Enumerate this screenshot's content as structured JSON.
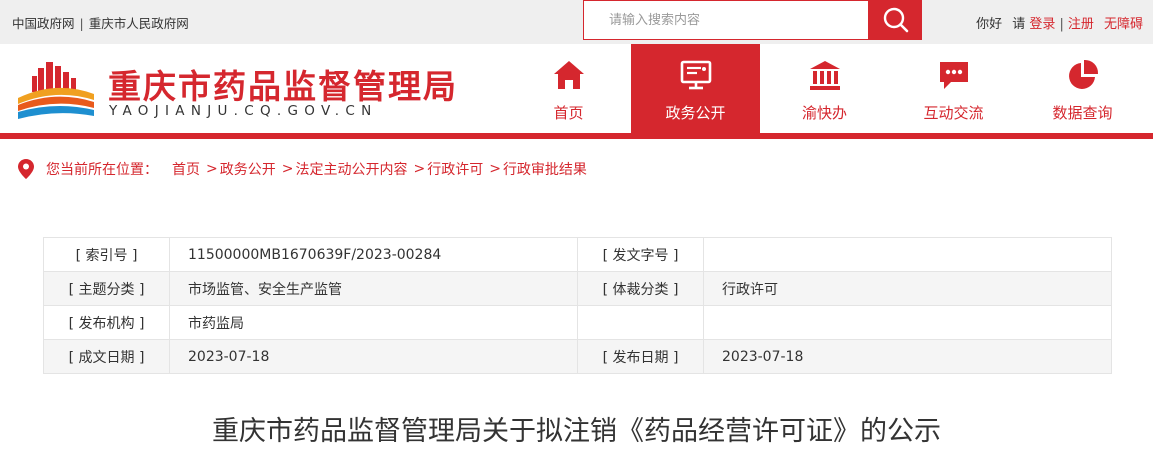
{
  "topbar": {
    "links": [
      "中国政府网",
      "重庆市人民政府网"
    ],
    "search_placeholder": "请输入搜索内容",
    "greeting": "你好",
    "please": "请",
    "login": "登录",
    "register": "注册",
    "accessibility": "无障碍"
  },
  "header": {
    "title": "重庆市药品监督管理局",
    "subtitle": "YAOJIANJU.CQ.GOV.CN",
    "nav": [
      {
        "label": "首页",
        "icon": "home-icon",
        "active": false
      },
      {
        "label": "政务公开",
        "icon": "monitor-icon",
        "active": true
      },
      {
        "label": "渝快办",
        "icon": "bank-icon",
        "active": false
      },
      {
        "label": "互动交流",
        "icon": "chat-icon",
        "active": false
      },
      {
        "label": "数据查询",
        "icon": "pie-chart-icon",
        "active": false
      }
    ]
  },
  "breadcrumb": {
    "lead": "您当前所在位置：",
    "items": [
      "首页",
      "政务公开",
      "法定主动公开内容",
      "行政许可",
      "行政审批结果"
    ]
  },
  "info": {
    "index_no_label": "[ 索引号 ]",
    "index_no": "11500000MB1670639F/2023-00284",
    "doc_no_label": "[ 发文字号 ]",
    "doc_no": "",
    "topic_label": "[ 主题分类 ]",
    "topic": "市场监管、安全生产监管",
    "genre_label": "[ 体裁分类 ]",
    "genre": "行政许可",
    "issuer_label": "[ 发布机构 ]",
    "issuer": "市药监局",
    "created_label": "[ 成文日期 ]",
    "created": "2023-07-18",
    "published_label": "[ 发布日期 ]",
    "published": "2023-07-18"
  },
  "article": {
    "title": "重庆市药品监督管理局关于拟注销《药品经营许可证》的公示"
  },
  "colors": {
    "brand_red": "#d5272e",
    "topbar_bg": "#efefef"
  }
}
